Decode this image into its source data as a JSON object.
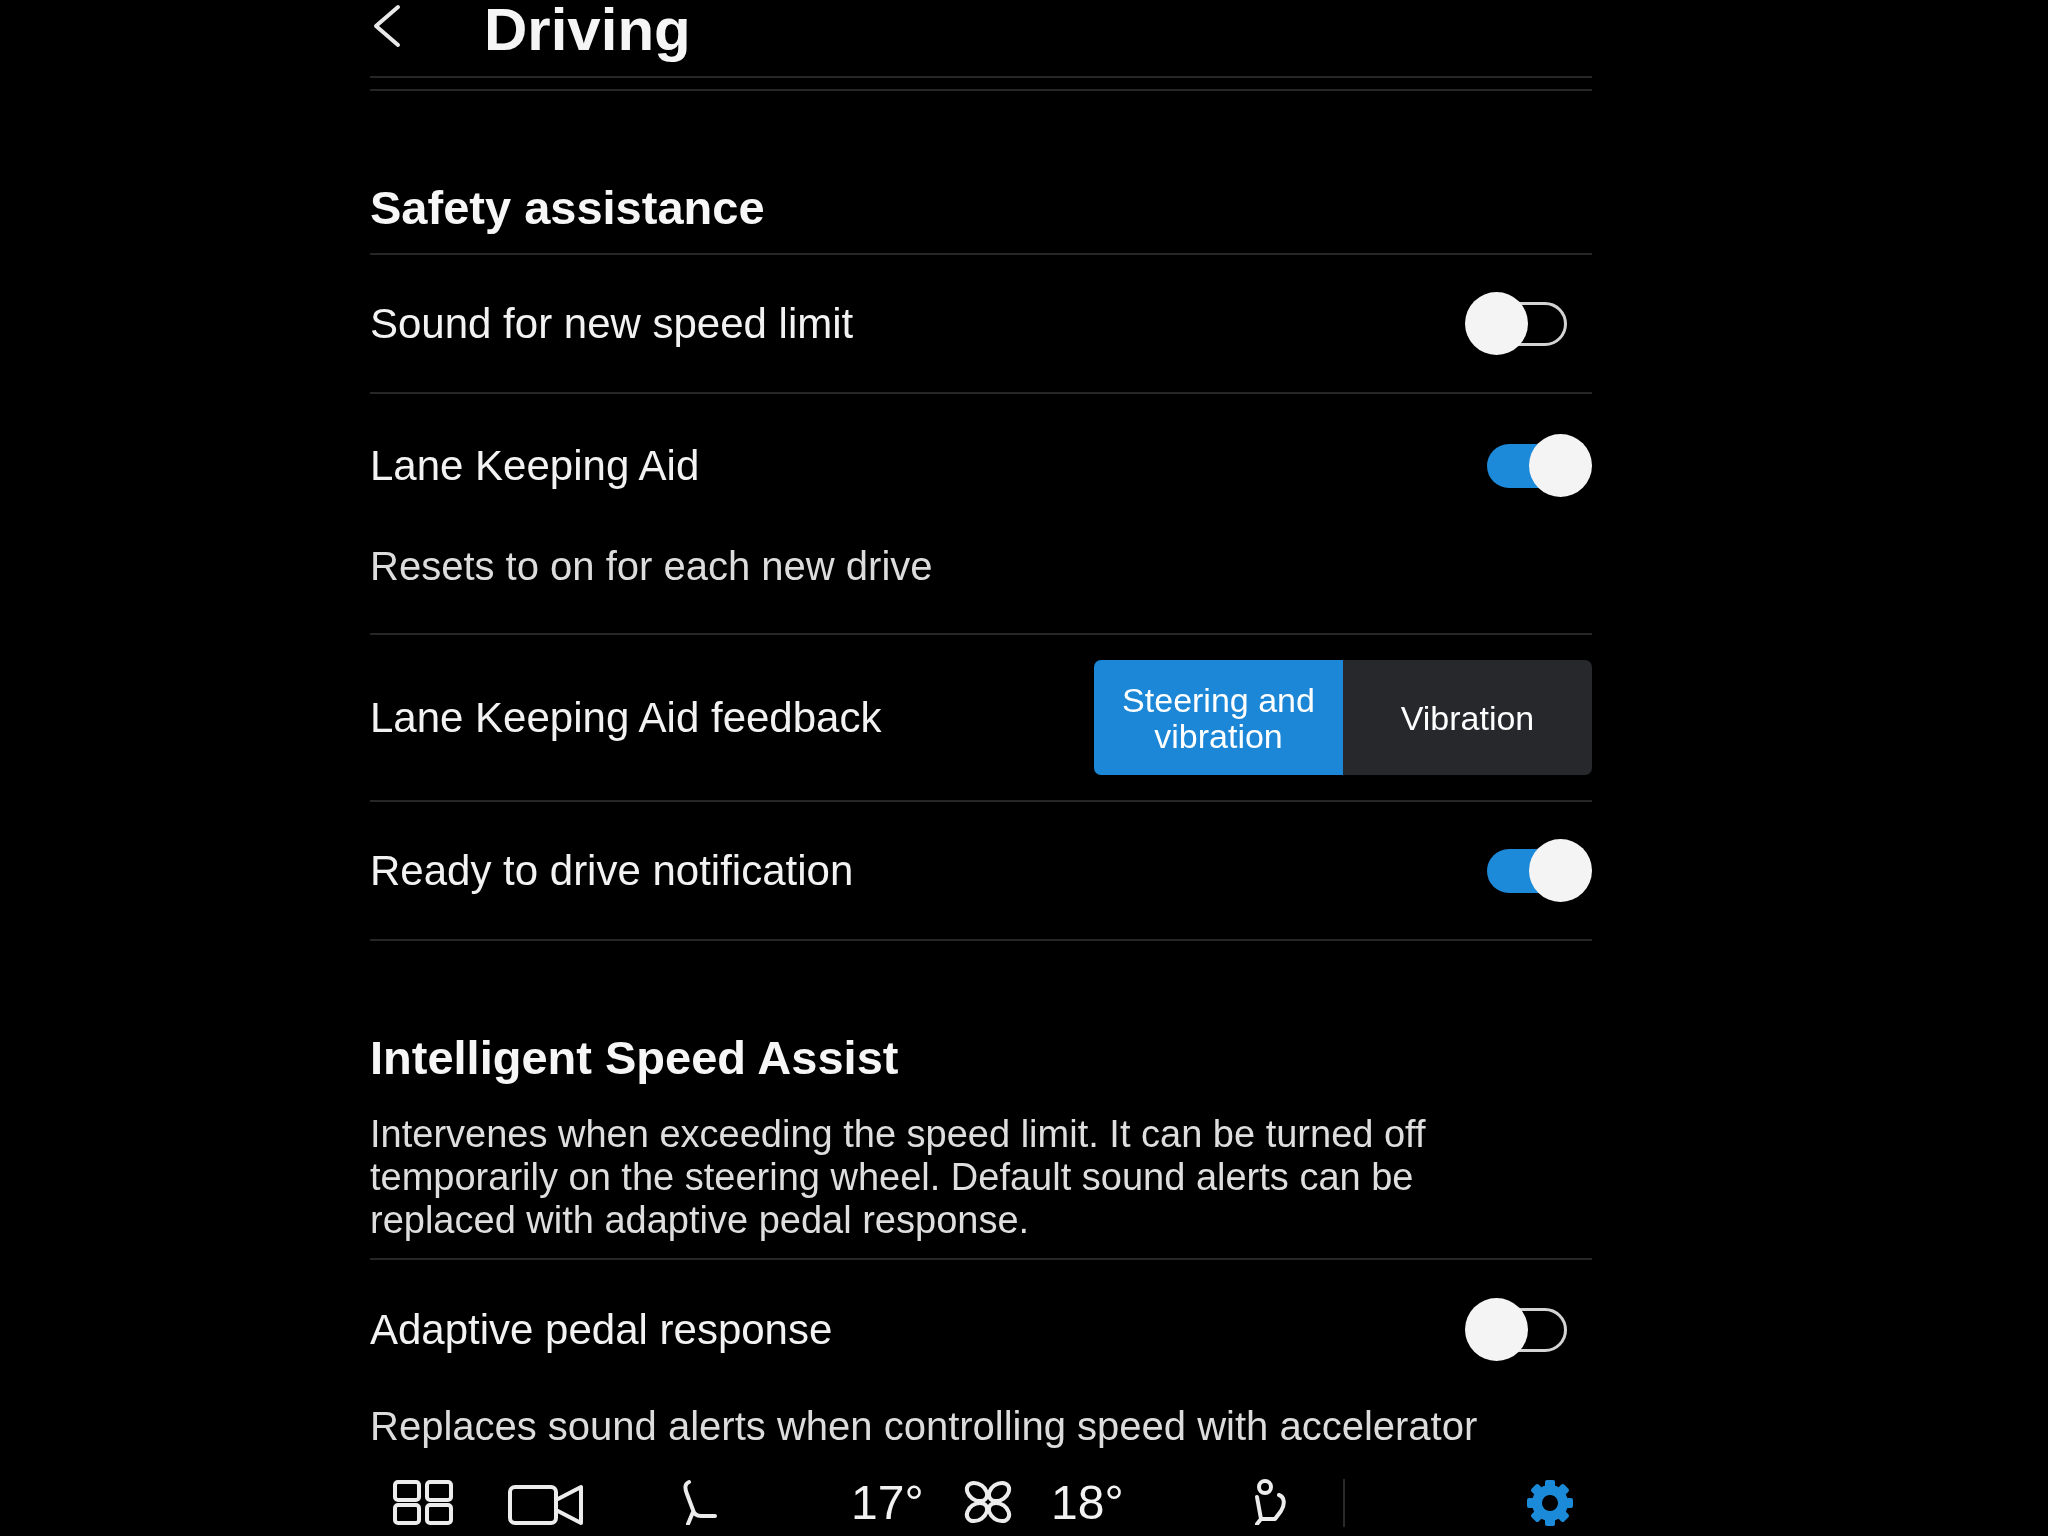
{
  "header": {
    "title": "Driving"
  },
  "sections": [
    {
      "title": "Safety assistance",
      "rows": [
        {
          "kind": "toggle",
          "label": "Sound for new speed limit",
          "on": false
        },
        {
          "kind": "toggle",
          "label": "Lane Keeping Aid",
          "on": true,
          "description": "Resets to on for each new drive"
        },
        {
          "kind": "segmented",
          "label": "Lane Keeping Aid feedback",
          "options": [
            {
              "label": "Steering and vibration",
              "selected": true
            },
            {
              "label": "Vibration",
              "selected": false
            }
          ]
        },
        {
          "kind": "toggle",
          "label": "Ready to drive notification",
          "on": true
        }
      ]
    },
    {
      "title": "Intelligent Speed Assist",
      "description": "Intervenes when exceeding the speed limit. It can be turned off temporarily on the steering wheel. Default sound alerts can be replaced with adaptive pedal response.",
      "rows": [
        {
          "kind": "toggle",
          "label": "Adaptive pedal response",
          "on": false,
          "description": "Replaces sound alerts when controlling speed with accelerator"
        }
      ]
    }
  ],
  "bottom_bar": {
    "left_temperature": "17°",
    "right_temperature": "18°",
    "settings_selected": true
  }
}
